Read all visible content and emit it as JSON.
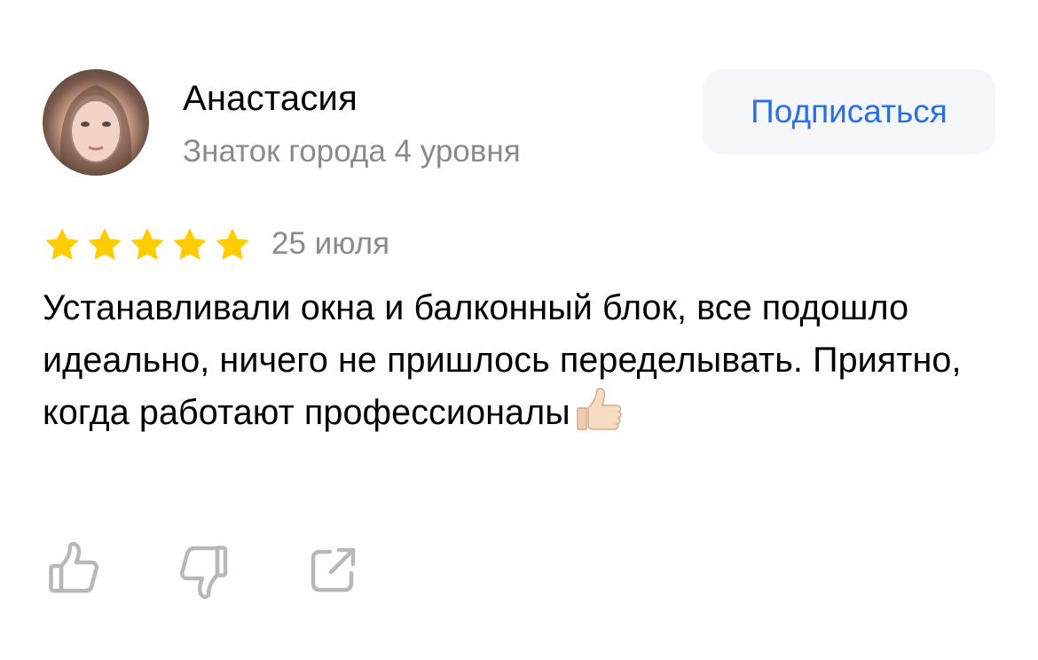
{
  "author": {
    "name": "Анастасия",
    "level": "Знаток города 4 уровня"
  },
  "subscribe_label": "Подписаться",
  "review": {
    "rating": 5,
    "rating_max": 5,
    "date": "25 июля",
    "text": "Устанавливали окна и балконный блок, все подошло идеально, ничего не пришлось переделывать. Приятно, когда работают профессионалы"
  },
  "actions": [
    {
      "icon": "thumbs-up-icon"
    },
    {
      "icon": "thumbs-down-icon"
    },
    {
      "icon": "share-icon"
    }
  ],
  "colors": {
    "star": "#ffcc00",
    "accent": "#2a6fe6",
    "muted_text": "#8a8a8a",
    "icon": "#b8b8b8",
    "button_bg": "#f4f6f9"
  }
}
